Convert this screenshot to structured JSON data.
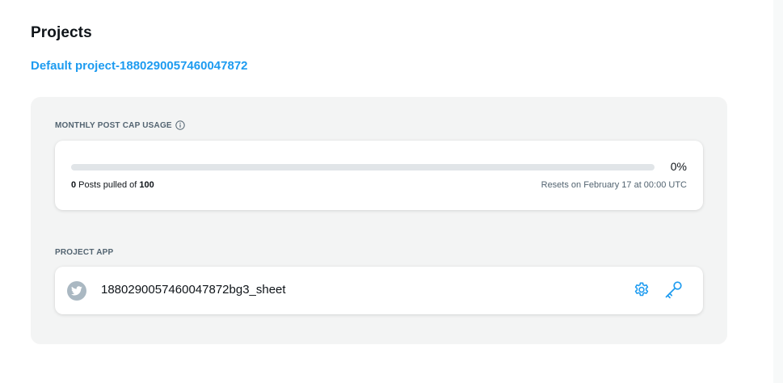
{
  "header": {
    "title": "Projects",
    "project_link": "Default project-1880290057460047872"
  },
  "usage": {
    "label": "MONTHLY POST CAP USAGE",
    "info_icon": "info-icon",
    "progress_fraction": 0,
    "percent_text": "0%",
    "posts_pulled": "0",
    "posts_pulled_middle": " Posts pulled of ",
    "posts_cap": "100",
    "reset_text": "Resets on February 17 at 00:00 UTC"
  },
  "project_app": {
    "label": "PROJECT APP",
    "avatar_icon": "twitter-bird-icon",
    "app_name": "1880290057460047872bg3_sheet",
    "settings_icon": "gear-icon",
    "keys_icon": "key-icon"
  },
  "colors": {
    "accent": "#1d9bf0",
    "panel_bg": "#f3f4f4",
    "progress_track": "#e1e5e8",
    "avatar_bg": "#aab8c2",
    "muted_text": "#536471"
  }
}
